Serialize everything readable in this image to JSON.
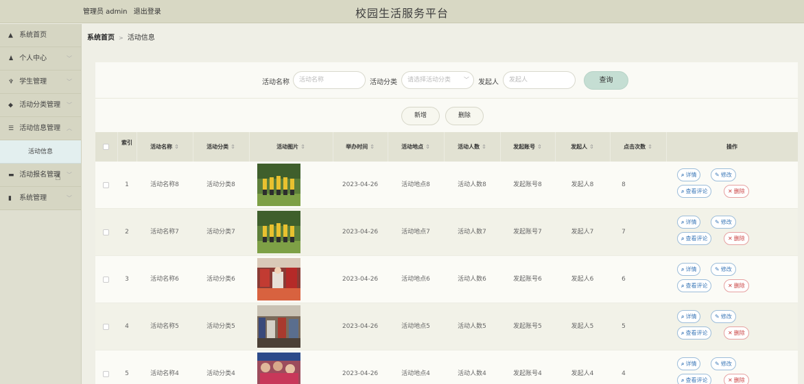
{
  "header": {
    "admin_label": "管理员 admin",
    "logout": "退出登录",
    "title": "校园生活服务平台"
  },
  "sidebar": {
    "items": [
      {
        "label": "系统首页",
        "icon": "home-icon",
        "glyph": "▲"
      },
      {
        "label": "个人中心",
        "icon": "user-icon",
        "glyph": "♟"
      },
      {
        "label": "学生管理",
        "icon": "student-icon",
        "glyph": "♆"
      },
      {
        "label": "活动分类管理",
        "icon": "category-icon",
        "glyph": "◆"
      },
      {
        "label": "活动信息管理",
        "icon": "list-icon",
        "glyph": "☰"
      },
      {
        "label": "活动报名管理",
        "icon": "signup-icon",
        "glyph": "▬"
      },
      {
        "label": "系统管理",
        "icon": "chart-icon",
        "glyph": "▮"
      }
    ],
    "sub_item": "活动信息"
  },
  "breadcrumb": {
    "home": "系统首页",
    "current": "活动信息"
  },
  "search": {
    "name_label": "活动名称",
    "name_placeholder": "活动名称",
    "category_label": "活动分类",
    "category_placeholder": "请选择活动分类",
    "initiator_label": "发起人",
    "initiator_placeholder": "发起人",
    "query_button": "查询"
  },
  "actions": {
    "add": "新增",
    "delete": "删除"
  },
  "table": {
    "columns": [
      "索引",
      "活动名称",
      "活动分类",
      "活动图片",
      "举办时间",
      "活动地点",
      "活动人数",
      "发起账号",
      "发起人",
      "点击次数",
      "操作"
    ],
    "rows": [
      {
        "idx": "1",
        "name": "活动名称8",
        "category": "活动分类8",
        "date": "2023-04-26",
        "place": "活动地点8",
        "count": "活动人数8",
        "account": "发起账号8",
        "initiator": "发起人8",
        "clicks": "8"
      },
      {
        "idx": "2",
        "name": "活动名称7",
        "category": "活动分类7",
        "date": "2023-04-26",
        "place": "活动地点7",
        "count": "活动人数7",
        "account": "发起账号7",
        "initiator": "发起人7",
        "clicks": "7"
      },
      {
        "idx": "3",
        "name": "活动名称6",
        "category": "活动分类6",
        "date": "2023-04-26",
        "place": "活动地点6",
        "count": "活动人数6",
        "account": "发起账号6",
        "initiator": "发起人6",
        "clicks": "6"
      },
      {
        "idx": "4",
        "name": "活动名称5",
        "category": "活动分类5",
        "date": "2023-04-26",
        "place": "活动地点5",
        "count": "活动人数5",
        "account": "发起账号5",
        "initiator": "发起人5",
        "clicks": "5"
      },
      {
        "idx": "5",
        "name": "活动名称4",
        "category": "活动分类4",
        "date": "2023-04-26",
        "place": "活动地点4",
        "count": "活动人数4",
        "account": "发起账号4",
        "initiator": "发起人4",
        "clicks": "4"
      }
    ],
    "op_labels": {
      "detail": "详情",
      "edit": "修改",
      "comments": "查看评论",
      "remove": "删除"
    }
  }
}
